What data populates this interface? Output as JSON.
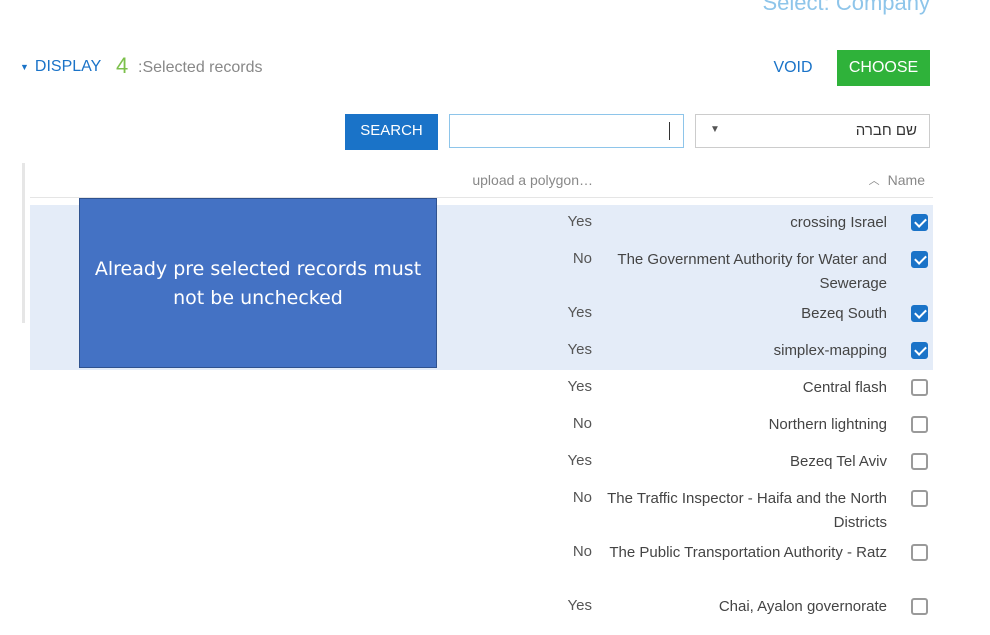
{
  "header": {
    "title": "Select: Company",
    "display_label": "DISPLAY",
    "selected_count": "4",
    "selected_label": ":Selected records",
    "void_label": "VOID",
    "choose_label": "CHOOSE"
  },
  "search": {
    "button_label": "SEARCH",
    "input_value": "",
    "field_selected": "שם חברה"
  },
  "table": {
    "columns": {
      "polygon": "upload a polygon…",
      "name": "Name"
    },
    "rows": [
      {
        "polygon": "Yes",
        "name": "crossing Israel",
        "checked": true
      },
      {
        "polygon": "No",
        "name": "The Government Authority for Water and Sewerage",
        "checked": true
      },
      {
        "polygon": "Yes",
        "name": "Bezeq South",
        "checked": true
      },
      {
        "polygon": "Yes",
        "name": "simplex-mapping",
        "checked": true
      },
      {
        "polygon": "Yes",
        "name": "Central flash",
        "checked": false
      },
      {
        "polygon": "No",
        "name": "Northern lightning",
        "checked": false
      },
      {
        "polygon": "Yes",
        "name": "Bezeq Tel Aviv",
        "checked": false
      },
      {
        "polygon": "No",
        "name": "The Traffic Inspector - Haifa and the North Districts",
        "checked": false
      },
      {
        "polygon": "No",
        "name": "The Public Transportation Authority - Ratz",
        "checked": false
      },
      {
        "polygon": "Yes",
        "name": "Chai, Ayalon governorate",
        "checked": false
      }
    ]
  },
  "callout": {
    "text": "Already pre selected records must not be unchecked"
  },
  "colors": {
    "accent_blue": "#1a73c8",
    "choose_green": "#2fb23a",
    "count_green": "#7cc04b",
    "selected_row": "#e4ecf8",
    "callout_fill": "#4472c4"
  }
}
